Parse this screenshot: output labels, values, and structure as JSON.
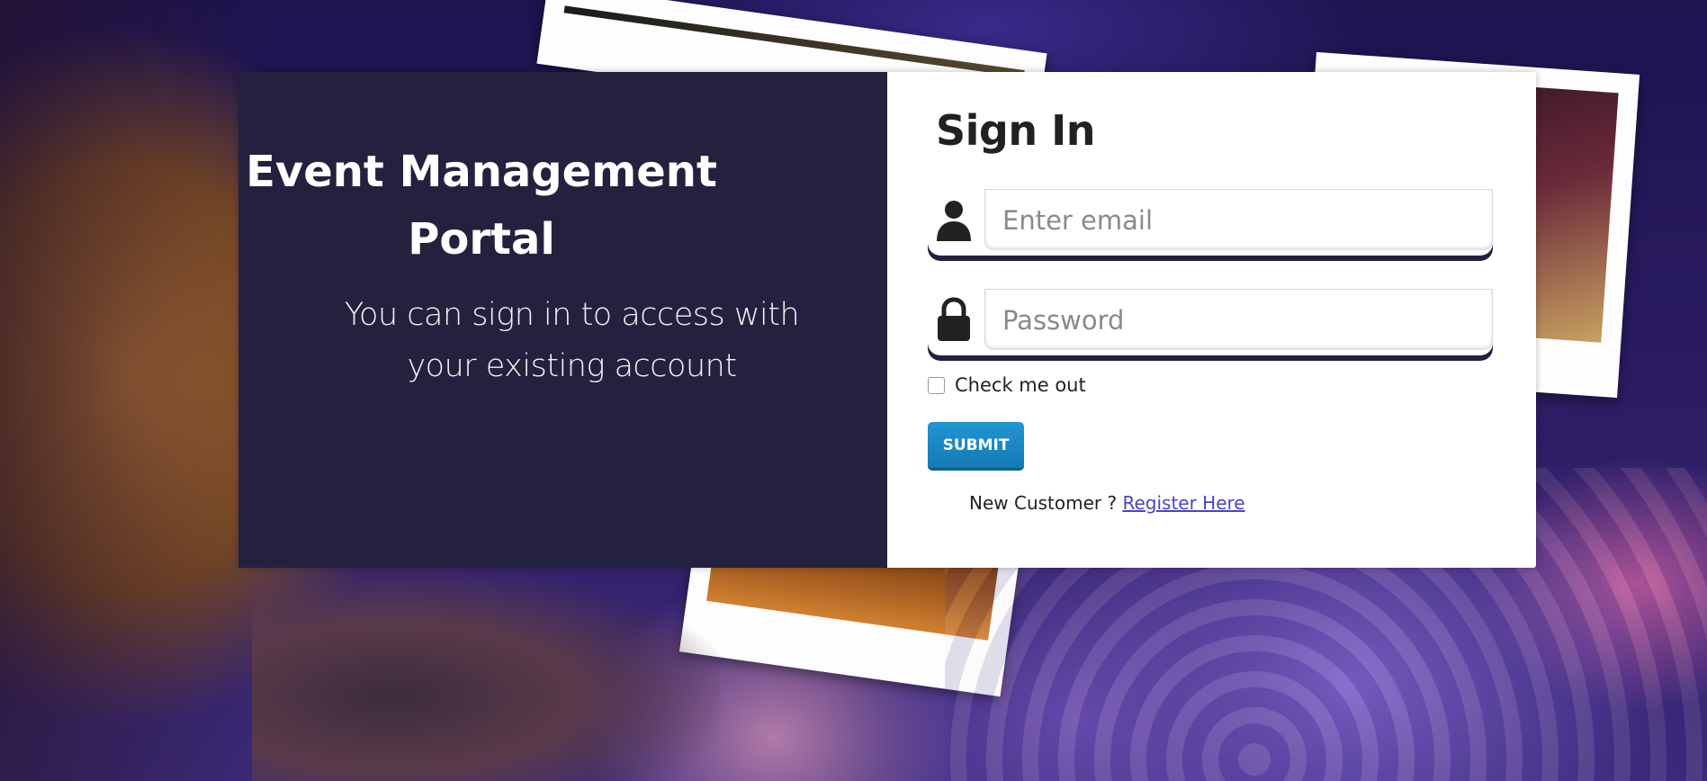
{
  "portal": {
    "title": "Event Management Portal",
    "subtitle": "You can sign in to access with your existing account"
  },
  "signin": {
    "heading": "Sign In",
    "email_placeholder": "Enter email",
    "password_placeholder": "Password",
    "remember_label": "Check me out",
    "submit_label": "SUBMIT",
    "new_customer_text": "New Customer ?",
    "register_link": "Register Here"
  },
  "icons": {
    "email": "user-icon",
    "password": "lock-icon"
  },
  "colors": {
    "panel_dark": "#24213f",
    "submit": "#1a87c4",
    "link": "#4a44c8"
  }
}
